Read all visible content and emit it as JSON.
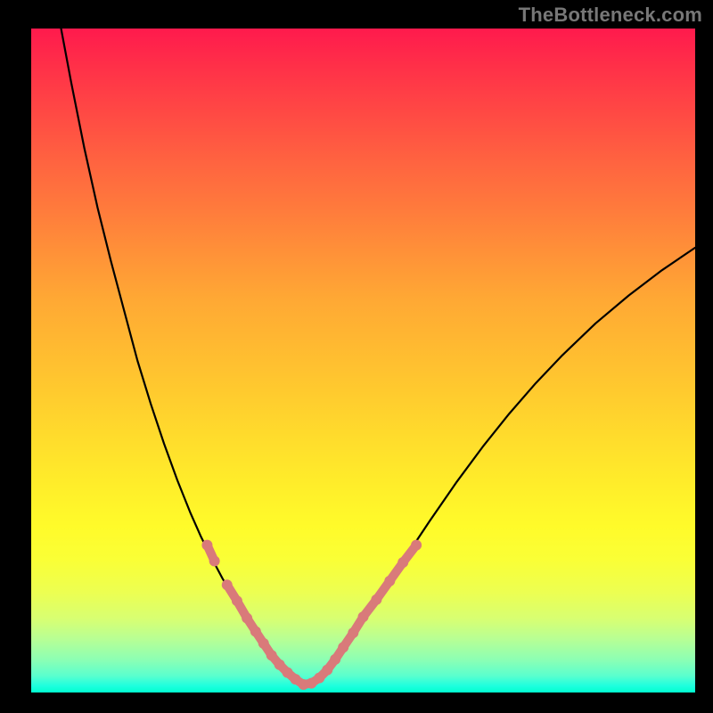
{
  "watermark": "TheBottleneck.com",
  "colors": {
    "background": "#000000",
    "gradient_top": "#ff1a4d",
    "gradient_bottom": "#00ffcf",
    "curve": "#000000",
    "markers": "#d97a7a"
  },
  "chart_data": {
    "type": "line",
    "title": "",
    "xlabel": "",
    "ylabel": "",
    "xlim": [
      0,
      100
    ],
    "ylim": [
      0,
      100
    ],
    "grid": false,
    "legend": false,
    "series": [
      {
        "name": "left-branch",
        "x": [
          4.5,
          6,
          8,
          10,
          12,
          14,
          16,
          18,
          20,
          22,
          24,
          25.6,
          27.2,
          28.8,
          30.4,
          32,
          33,
          34,
          35,
          36,
          37,
          38
        ],
        "y": [
          100,
          92,
          82,
          73,
          65,
          57.5,
          50,
          43.5,
          37.5,
          32,
          27,
          23.4,
          20.2,
          17.2,
          14.4,
          11.7,
          10.1,
          8.5,
          7,
          5.5,
          4.2,
          3
        ]
      },
      {
        "name": "valley",
        "x": [
          38,
          39,
          40,
          41,
          42,
          43,
          44
        ],
        "y": [
          3,
          2,
          1.3,
          1,
          1.3,
          2,
          3
        ]
      },
      {
        "name": "right-branch",
        "x": [
          44,
          46,
          48,
          50,
          53,
          56,
          60,
          64,
          68,
          72,
          76,
          80,
          85,
          90,
          95,
          100
        ],
        "y": [
          3,
          5.4,
          8,
          10.8,
          15.2,
          19.8,
          25.8,
          31.6,
          37,
          42,
          46.6,
          50.8,
          55.6,
          59.8,
          63.6,
          67
        ]
      }
    ],
    "highlighted_points": {
      "name": "markers",
      "x": [
        26.5,
        27.6,
        29.5,
        31,
        32.5,
        33.8,
        35,
        36.2,
        37.4,
        38.6,
        39.8,
        41,
        42.2,
        43.4,
        44.6,
        45.8,
        47,
        48.5,
        50,
        52,
        54,
        56,
        58
      ],
      "y": [
        22.2,
        19.8,
        16.2,
        13.8,
        11.2,
        9.2,
        7.4,
        5.6,
        4.2,
        3,
        2,
        1.2,
        1.4,
        2.2,
        3.4,
        5,
        6.8,
        9,
        11.4,
        14,
        16.8,
        19.6,
        22.2
      ]
    }
  }
}
